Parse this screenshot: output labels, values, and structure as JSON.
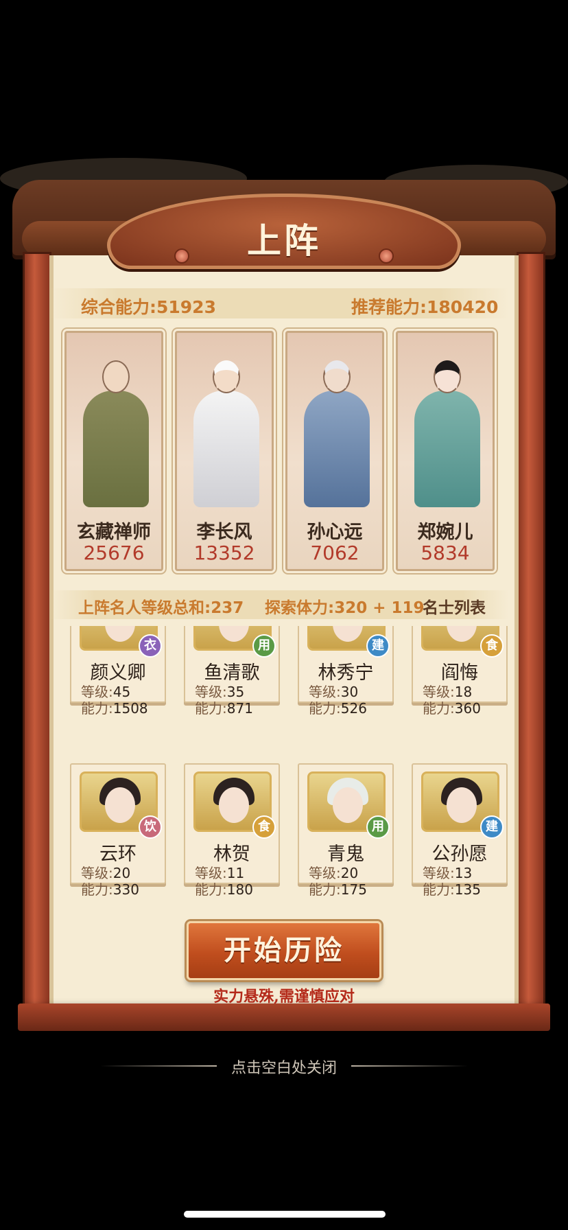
{
  "panel": {
    "title": "上阵"
  },
  "stats": {
    "total_label": "综合能力:51923",
    "recommend_label": "推荐能力:180420"
  },
  "lineup": [
    {
      "name": "玄藏禅师",
      "power": "25676"
    },
    {
      "name": "李长风",
      "power": "13352"
    },
    {
      "name": "孙心远",
      "power": "7062"
    },
    {
      "name": "郑婉儿",
      "power": "5834"
    }
  ],
  "info": {
    "level_sum": "上阵名人等级总和:237",
    "stamina": "探索体力:320 + 119",
    "list_button": "名士列表"
  },
  "roster": [
    {
      "name": "颜义卿",
      "badge": "衣",
      "badge_color": "#8a62b8",
      "level": "45",
      "power": "1508"
    },
    {
      "name": "鱼清歌",
      "badge": "用",
      "badge_color": "#5a9a46",
      "level": "35",
      "power": "871"
    },
    {
      "name": "林秀宁",
      "badge": "建",
      "badge_color": "#3e8ac6",
      "level": "30",
      "power": "526"
    },
    {
      "name": "阎悔",
      "badge": "食",
      "badge_color": "#d6a03a",
      "level": "18",
      "power": "360"
    },
    {
      "name": "云环",
      "badge": "饮",
      "badge_color": "#c86a7a",
      "level": "20",
      "power": "330"
    },
    {
      "name": "林贺",
      "badge": "食",
      "badge_color": "#d6a03a",
      "level": "11",
      "power": "180"
    },
    {
      "name": "青鬼",
      "badge": "用",
      "badge_color": "#5a9a46",
      "level": "20",
      "power": "175"
    },
    {
      "name": "公孙愿",
      "badge": "建",
      "badge_color": "#3e8ac6",
      "level": "13",
      "power": "135"
    }
  ],
  "labels": {
    "level": "等级:",
    "power": "能力:"
  },
  "actions": {
    "start": "开始历险",
    "warning": "实力悬殊,需谨慎应对"
  },
  "close_hint": "点击空白处关闭"
}
